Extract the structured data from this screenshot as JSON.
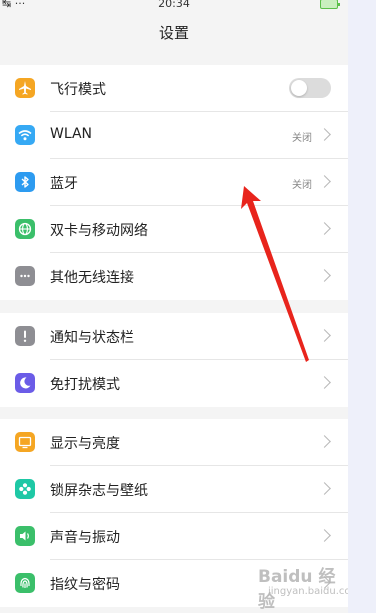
{
  "status_bar": {
    "left": "↹ ···",
    "time": "20:34"
  },
  "nav": {
    "title": "设置"
  },
  "groups": [
    {
      "items": [
        {
          "label": "飞行模式",
          "icon": "airplane-icon",
          "color": "#f5a623",
          "control": "toggle",
          "toggle_on": false
        },
        {
          "label": "WLAN",
          "icon": "wifi-icon",
          "color": "#36a9f4",
          "status": "关闭"
        },
        {
          "label": "蓝牙",
          "icon": "bluetooth-icon",
          "color": "#2d9bf0",
          "status": "关闭"
        },
        {
          "label": "双卡与移动网络",
          "icon": "globe-icon",
          "color": "#3bbf6a"
        },
        {
          "label": "其他无线连接",
          "icon": "more-icon",
          "color": "#8e8e93"
        }
      ]
    },
    {
      "items": [
        {
          "label": "通知与状态栏",
          "icon": "alert-icon",
          "color": "#8e8e93"
        },
        {
          "label": "免打扰模式",
          "icon": "moon-icon",
          "color": "#6b5ce7"
        }
      ]
    },
    {
      "items": [
        {
          "label": "显示与亮度",
          "icon": "display-icon",
          "color": "#f5a623"
        },
        {
          "label": "锁屏杂志与壁纸",
          "icon": "flower-icon",
          "color": "#1ec8a5"
        },
        {
          "label": "声音与振动",
          "icon": "speaker-icon",
          "color": "#3bbf6a"
        },
        {
          "label": "指纹与密码",
          "icon": "fingerprint-icon",
          "color": "#3bbf6a"
        }
      ]
    }
  ],
  "annotation": {
    "color": "#e8241c"
  },
  "watermark": {
    "text": "Baidu 经验",
    "sub": "jingyan.baidu.com"
  }
}
